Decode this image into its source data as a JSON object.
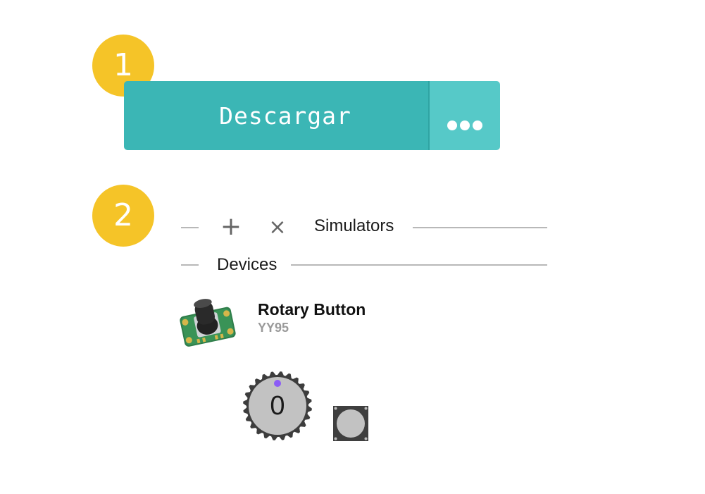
{
  "steps": {
    "one": "1",
    "two": "2"
  },
  "toolbar": {
    "download_label": "Descargar",
    "more_icon": "ellipsis-icon"
  },
  "simulator_panel": {
    "collapse_icon": "minus-icon",
    "add_icon": "plus-icon",
    "close_icon": "close-icon",
    "add_symbol": "+",
    "close_symbol": "×",
    "simulators_label": "Simulators",
    "devices_label": "Devices"
  },
  "device": {
    "name": "Rotary Button",
    "code": "YY95"
  },
  "simulator": {
    "knob_value": "0",
    "knob_indicator_color": "#8b5cf6"
  },
  "colors": {
    "badge": "#f5c428",
    "download": "#3bb6b5",
    "more": "#56c9c8"
  }
}
